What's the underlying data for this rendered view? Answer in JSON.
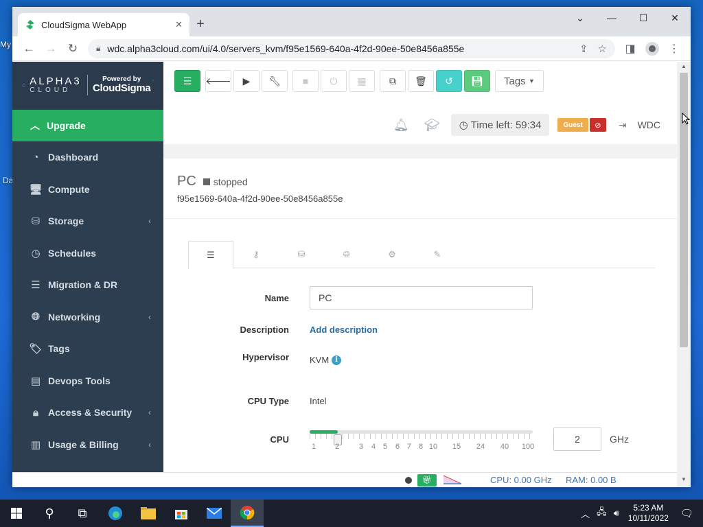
{
  "desktop": {
    "label_1": "My",
    "label_2": "Da"
  },
  "browser": {
    "tab_title": "CloudSigma WebApp",
    "tab_close": "✕",
    "newtab": "+",
    "url": "wdc.alpha3cloud.com/ui/4.0/servers_kvm/f95e1569-640a-4f2d-90ee-50e8456a855e"
  },
  "brand": {
    "alpha_line1": "ALPHA3",
    "alpha_line2": "CLOUD",
    "powered_by": "Powered by",
    "cloudsigma": "CloudSigma"
  },
  "sidebar": {
    "upgrade": "Upgrade",
    "items": [
      {
        "label": "Dashboard",
        "icon": "dashboard-icon",
        "caret": false
      },
      {
        "label": "Compute",
        "icon": "monitor-icon",
        "caret": false
      },
      {
        "label": "Storage",
        "icon": "drive-icon",
        "caret": true
      },
      {
        "label": "Schedules",
        "icon": "clock-icon",
        "caret": false
      },
      {
        "label": "Migration & DR",
        "icon": "server-icon",
        "caret": false
      },
      {
        "label": "Networking",
        "icon": "globe-icon",
        "caret": true
      },
      {
        "label": "Tags",
        "icon": "tags-icon",
        "caret": false
      },
      {
        "label": "Devops Tools",
        "icon": "tools-icon",
        "caret": false
      },
      {
        "label": "Access & Security",
        "icon": "lock-icon",
        "caret": true
      },
      {
        "label": "Usage & Billing",
        "icon": "bar-chart-icon",
        "caret": true
      }
    ]
  },
  "toolbar": {
    "tags_label": "Tags"
  },
  "status": {
    "time_left": "Time left: 59:34",
    "guest": "Guest",
    "wdc": "WDC"
  },
  "server": {
    "name": "PC",
    "state": "stopped",
    "uuid": "f95e1569-640a-4f2d-90ee-50e8456a855e"
  },
  "form": {
    "name_label": "Name",
    "name_value": "PC",
    "description_label": "Description",
    "description_link": "Add description",
    "hypervisor_label": "Hypervisor",
    "hypervisor_value": "KVM",
    "cputype_label": "CPU Type",
    "cputype_value": "Intel",
    "cpu_label": "CPU",
    "cpu_value": "2",
    "cpu_unit": "GHz",
    "cpu_fraction": 0.125,
    "cpu_ticks": [
      "1",
      "2",
      "3",
      "4",
      "5",
      "6",
      "7",
      "8",
      "10",
      "15",
      "24",
      "40",
      "100"
    ]
  },
  "footer": {
    "cpu_stat": "CPU: 0.00 GHz",
    "ram_stat": "RAM: 0.00 B"
  },
  "taskbar": {
    "time": "5:23 AM",
    "date": "10/11/2022"
  },
  "colors": {
    "accent_green": "#27ae60",
    "sidebar_bg": "#2d3e50",
    "teal": "#48d1cc",
    "guest_orange": "#f0ad4e",
    "danger_red": "#c9302c",
    "link_blue": "#2c6aa0"
  }
}
